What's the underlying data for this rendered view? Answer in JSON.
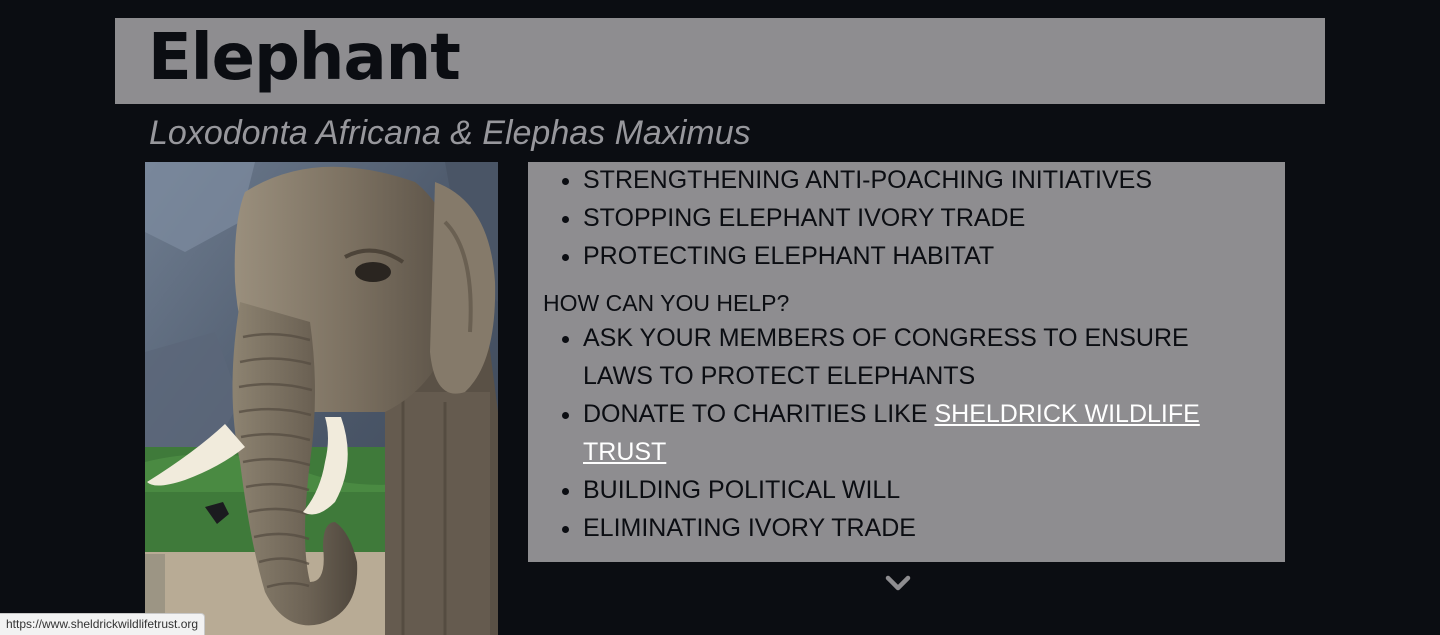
{
  "header": {
    "title": "Elephant",
    "subtitle": "Loxodonta Africana & Elephas Maximus"
  },
  "photo": {
    "subject": "elephant"
  },
  "info": {
    "top_items": [
      "STRENGTHENING ANTI-POACHING INITIATIVES",
      "STOPPING ELEPHANT IVORY TRADE",
      "PROTECTING ELEPHANT HABITAT"
    ],
    "help_heading": "HOW CAN YOU HELP?",
    "help_items": {
      "congress": "ASK YOUR MEMBERS OF CONGRESS TO ENSURE LAWS TO PROTECT ELEPHANTS",
      "donate_prefix": "DONATE TO CHARITIES LIKE ",
      "donate_link": "SHELDRICK WILDLIFE TRUST",
      "political": "BUILDING POLITICAL WILL",
      "ivory": "ELIMINATING IVORY TRADE"
    }
  },
  "scroll_indicator": {
    "icon": "chevron-down-icon"
  },
  "status_bar": {
    "url": "https://www.sheldrickwildlifetrust.org"
  },
  "colors": {
    "background": "#0b0d12",
    "panel": "#8e8d90",
    "subtitle": "#97979c",
    "link": "#ffffff"
  }
}
